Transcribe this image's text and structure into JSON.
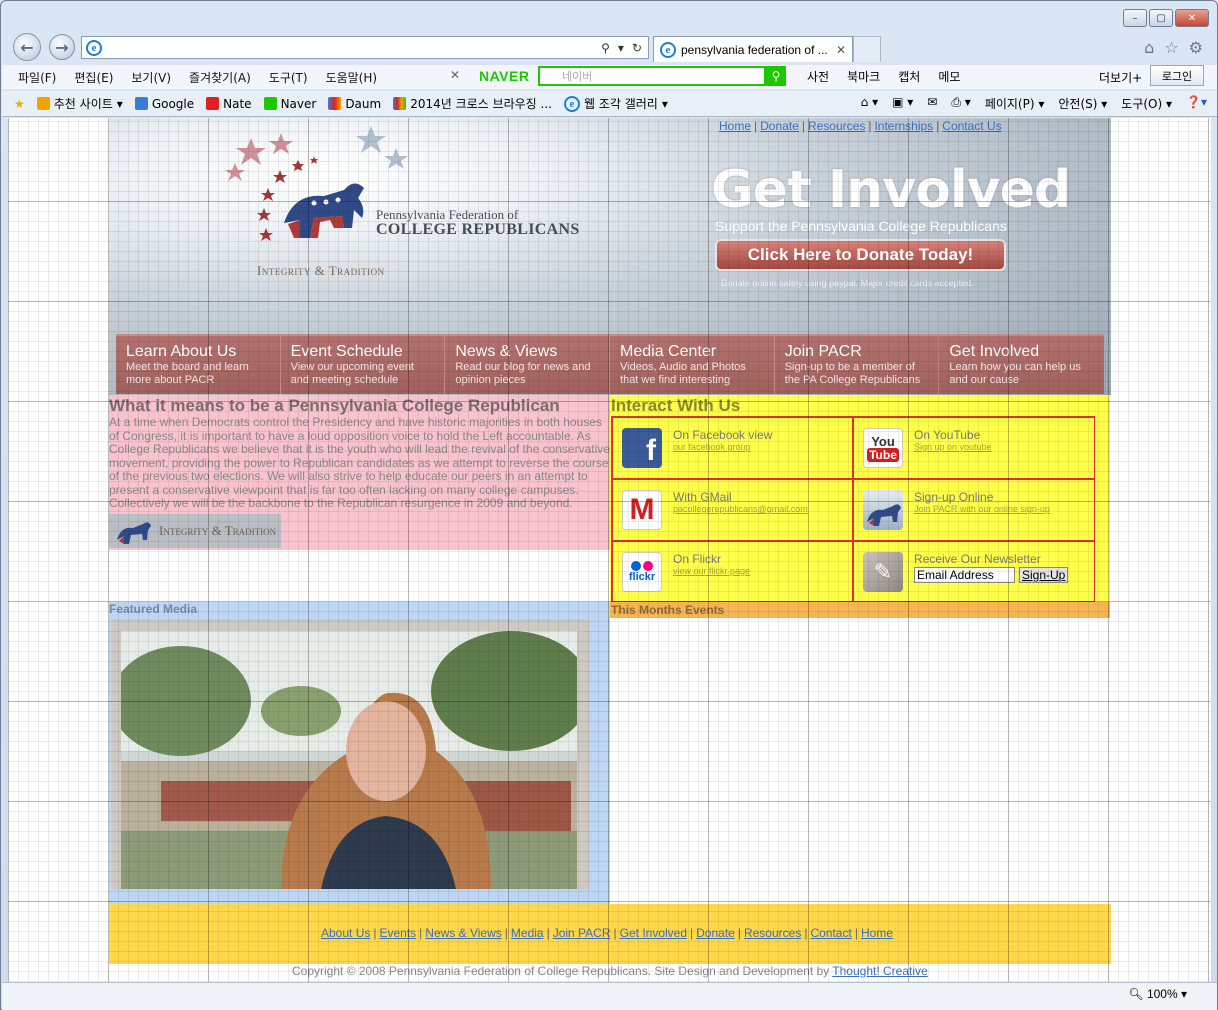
{
  "window": {
    "minimize": "–",
    "maximize": "▢",
    "close": "✕"
  },
  "browser": {
    "address_value": "",
    "tab_title": "pensylvania federation of ...",
    "menu": [
      "파일(F)",
      "편집(E)",
      "보기(V)",
      "즐겨찾기(A)",
      "도구(T)",
      "도움말(H)"
    ],
    "naver_logo": "NAVER",
    "naver_search_placeholder": "네이버",
    "naver_tools": [
      "사전",
      "북마크",
      "캡처",
      "메모"
    ],
    "more": "더보기+",
    "login": "로그인",
    "favorites": [
      "추천 사이트",
      "Google",
      "Nate",
      "Naver",
      "Daum",
      "2014년 크로스 브라우징 ...",
      "웹 조각 갤러리"
    ],
    "commands": [
      "페이지(P)",
      "안전(S)",
      "도구(O)"
    ],
    "zoom": "100%",
    "colors": {
      "naver_green": "#1ec800",
      "link_blue": "#3a6fc4"
    }
  },
  "page": {
    "top_links": [
      "Home",
      "Donate",
      "Resources",
      "Internships",
      "Contact Us"
    ],
    "logo_line1": "Pennsylvania Federation of",
    "logo_line2": "COLLEGE REPUBLICANS",
    "motto": "Integrity & Tradition",
    "get_involved": "Get Involved",
    "support_line": "Support the Pennsylvania College Republicans",
    "donate_button": "Click Here to Donate Today!",
    "donate_note": "Donate online safely using paypal. Major credit cards accepted.",
    "nav": [
      {
        "title": "Learn About Us",
        "desc": "Meet the board and learn more about PACR"
      },
      {
        "title": "Event Schedule",
        "desc": "View our upcoming event and meeting schedule"
      },
      {
        "title": "News & Views",
        "desc": "Read our blog for news and opinion pieces"
      },
      {
        "title": "Media Center",
        "desc": "Videos, Audio and Photos that we find interesting"
      },
      {
        "title": "Join PACR",
        "desc": "Sign-up to be a member of the PA College Republicans"
      },
      {
        "title": "Get Involved",
        "desc": "Learn how you can help us and our cause"
      }
    ],
    "what_title": "What it means to be a Pennsylvania College Republican",
    "what_body": "At a time when Democrats control the Presidency and have historic majorities in both houses of Congress, it is important to have a loud opposition voice to hold the Left accountable. As College Republicans we believe that it is the youth who will lead the revival of the conservative movement, providing the power to Republican candidates as we attempt to reverse the course of the previous two elections. We will also strive to help educate our peers in an attempt to present a conservative viewpoint that is far too often lacking on many college campuses. Collectively we will be the backbone to the Republican resurgence in 2009 and beyond.",
    "interact_title": "Interact With Us",
    "interact": [
      {
        "heading": "On Facebook view",
        "sub": "our facebook group",
        "icon": "facebook-icon"
      },
      {
        "heading": "On YouTube",
        "sub": "Sign up on youtube",
        "icon": "youtube-icon"
      },
      {
        "heading": "With GMail",
        "sub": "pacollegerepublicans@gmail.com",
        "icon": "gmail-icon"
      },
      {
        "heading": "Sign-up Online",
        "sub": "Join PACR with our online sign-up",
        "icon": "elephant-icon"
      },
      {
        "heading": "On Flickr",
        "sub": "view our flickr page",
        "icon": "flickr-icon"
      },
      {
        "heading": "Receive Our Newsletter",
        "sub": "",
        "icon": "newsletter-icon"
      }
    ],
    "newsletter_input_value": "Email Address",
    "newsletter_button": "Sign-Up",
    "events_title": "This Months Events",
    "featured_title": "Featured Media",
    "footer_links": [
      "About Us",
      "Events",
      "News & Views",
      "Media",
      "Join PACR",
      "Get Involved",
      "Donate",
      "Resources",
      "Contact",
      "Home"
    ],
    "copyright_text": "Copyright © 2008 Pennsylvania Federation of College Republicans. Site Design and Development by",
    "copyright_link": "Thought! Creative"
  }
}
